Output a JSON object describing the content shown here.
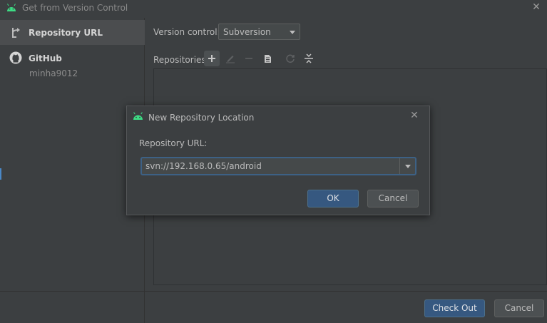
{
  "window": {
    "title": "Get from Version Control"
  },
  "sidebar": {
    "items": [
      {
        "label": "Repository URL",
        "icon": "vcs-icon",
        "selected": true
      },
      {
        "label": "GitHub",
        "sub": "minha9012",
        "icon": "github-icon",
        "selected": false
      }
    ]
  },
  "main": {
    "version_control_label": "Version control:",
    "version_control_value": "Subversion",
    "repositories_label": "Repositories:",
    "toolbar": [
      "add-icon",
      "edit-icon",
      "remove-icon",
      "copy-icon",
      "refresh-icon",
      "collapse-icon"
    ]
  },
  "dialog": {
    "title": "New Repository Location",
    "url_label": "Repository URL:",
    "url_value": "svn://192.168.0.65/android",
    "ok_label": "OK",
    "cancel_label": "Cancel"
  },
  "footer": {
    "checkout_label": "Check Out",
    "cancel_label": "Cancel"
  },
  "colors": {
    "background": "#3c3f41",
    "primary_button": "#365880",
    "android_green": "#3ddc84",
    "focus_border": "#3d6185"
  }
}
